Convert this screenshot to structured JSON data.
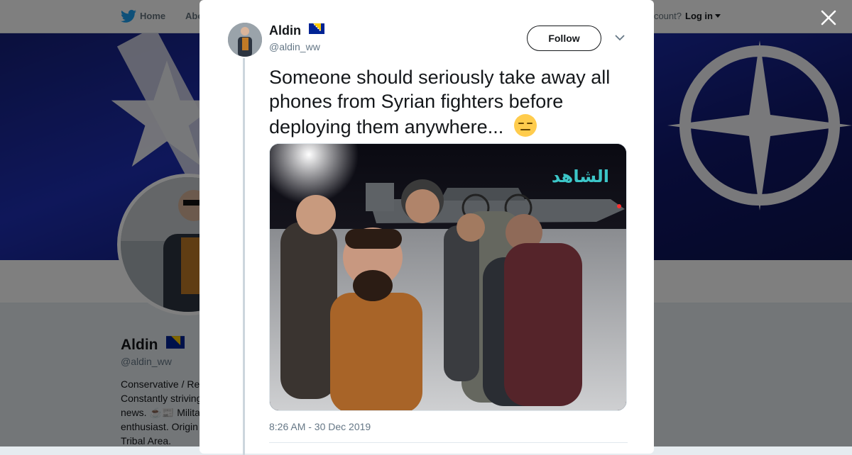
{
  "nav": {
    "home": "Home",
    "about": "Abo",
    "account_prompt": "ccount?",
    "login": "Log in"
  },
  "profile": {
    "name": "Aldin",
    "handle": "@aldin_ww",
    "bio_lines": [
      "Conservative / Re",
      "Constantly striving",
      "news. ☕📰 Milita",
      "enthusiast. Origin",
      "Tribal Area."
    ]
  },
  "tweet": {
    "author_name": "Aldin",
    "author_handle": "@aldin_ww",
    "follow_label": "Follow",
    "text": "Someone should seriously take away all phones from Syrian fighters before deploying them anywhere...",
    "photo_watermark": "الشاهد",
    "timestamp": "8:26 AM - 30 Dec 2019"
  },
  "colors": {
    "twitter_blue": "#1da1f2",
    "text_primary": "#14171a",
    "text_secondary": "#657786",
    "banner_blue": "#1e2fb5"
  },
  "icons": {
    "close": "close-icon",
    "bird": "twitter-bird-icon",
    "chevron": "chevron-down-icon",
    "flag": "bosnia-flag-icon",
    "emoji": "expressionless-face-emoji"
  }
}
